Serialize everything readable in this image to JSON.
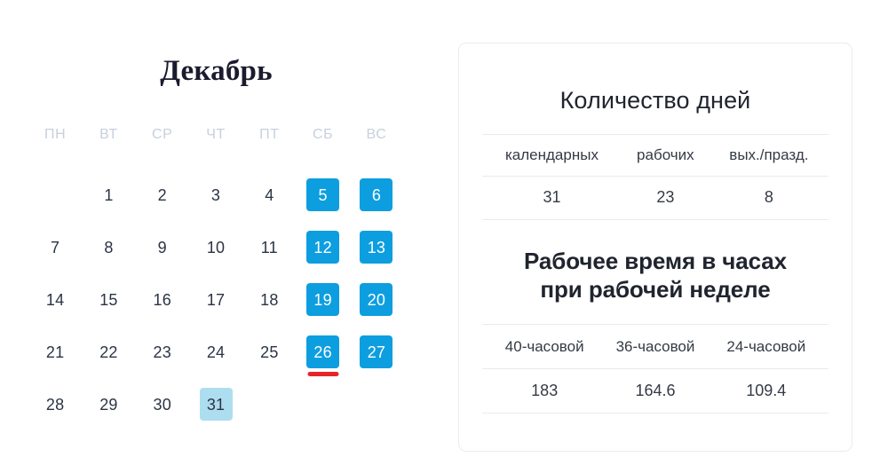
{
  "calendar": {
    "month_title": "Декабрь",
    "weekday_headers": [
      "ПН",
      "ВТ",
      "СР",
      "ЧТ",
      "ПТ",
      "СБ",
      "ВС"
    ],
    "leading_blanks": 1,
    "days": [
      {
        "n": "1",
        "type": "work"
      },
      {
        "n": "2",
        "type": "work"
      },
      {
        "n": "3",
        "type": "work"
      },
      {
        "n": "4",
        "type": "work"
      },
      {
        "n": "5",
        "type": "weekend"
      },
      {
        "n": "6",
        "type": "weekend"
      },
      {
        "n": "7",
        "type": "work"
      },
      {
        "n": "8",
        "type": "work"
      },
      {
        "n": "9",
        "type": "work"
      },
      {
        "n": "10",
        "type": "work"
      },
      {
        "n": "11",
        "type": "work"
      },
      {
        "n": "12",
        "type": "weekend"
      },
      {
        "n": "13",
        "type": "weekend"
      },
      {
        "n": "14",
        "type": "work"
      },
      {
        "n": "15",
        "type": "work"
      },
      {
        "n": "16",
        "type": "work"
      },
      {
        "n": "17",
        "type": "work"
      },
      {
        "n": "18",
        "type": "work"
      },
      {
        "n": "19",
        "type": "weekend"
      },
      {
        "n": "20",
        "type": "weekend"
      },
      {
        "n": "21",
        "type": "work"
      },
      {
        "n": "22",
        "type": "work"
      },
      {
        "n": "23",
        "type": "work"
      },
      {
        "n": "24",
        "type": "work"
      },
      {
        "n": "25",
        "type": "work"
      },
      {
        "n": "26",
        "type": "weekend",
        "marker": true
      },
      {
        "n": "27",
        "type": "weekend"
      },
      {
        "n": "28",
        "type": "work"
      },
      {
        "n": "29",
        "type": "work"
      },
      {
        "n": "30",
        "type": "work"
      },
      {
        "n": "31",
        "type": "short"
      }
    ],
    "colors": {
      "weekend_bg": "#0d9ee0",
      "weekend_text": "#ffffff",
      "short_bg": "#addeef",
      "short_text": "#2b3445",
      "work_text": "#2b3445",
      "weekday_header": "#c7d0dd",
      "marker": "#e8232a",
      "title": "#1b1b2f"
    }
  },
  "panel": {
    "days_section": {
      "heading": "Количество дней",
      "columns": [
        "календарных",
        "рабочих",
        "вых./празд."
      ],
      "values": [
        "31",
        "23",
        "8"
      ]
    },
    "hours_section": {
      "heading_line1": "Рабочее время в часах",
      "heading_line2": "при рабочей неделе",
      "columns": [
        "40-часовой",
        "36-часовой",
        "24-часовой"
      ],
      "values": [
        "183",
        "164.6",
        "109.4"
      ]
    },
    "border_color": "#ececee"
  }
}
